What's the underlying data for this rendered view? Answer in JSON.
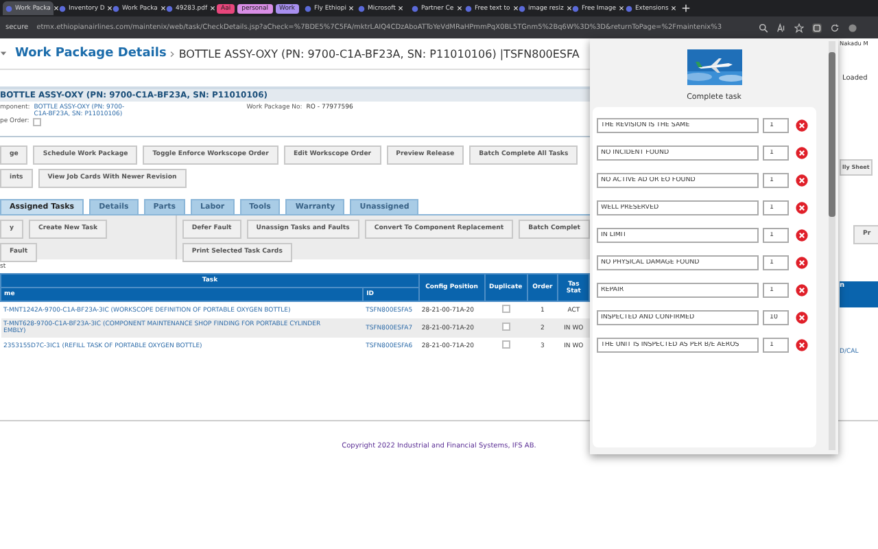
{
  "browser": {
    "tabs": [
      {
        "kind": "tab",
        "title": "Work Packa",
        "selected": true
      },
      {
        "kind": "tab",
        "title": "Inventory D",
        "selected": false
      },
      {
        "kind": "tab",
        "title": "Work Packa",
        "selected": false
      },
      {
        "kind": "tab",
        "title": "49283.pdf",
        "selected": false
      },
      {
        "kind": "group",
        "title": "Aai",
        "color": "#e8467c"
      },
      {
        "kind": "group",
        "title": "personal",
        "color": "#d98ee6"
      },
      {
        "kind": "group",
        "title": "Work",
        "color": "#a88ff0"
      },
      {
        "kind": "tab",
        "title": "Fly Ethiopi",
        "selected": false
      },
      {
        "kind": "tab",
        "title": "Microsoft",
        "selected": false
      },
      {
        "kind": "tab",
        "title": "Partner Ce",
        "selected": false
      },
      {
        "kind": "tab",
        "title": "Free text to",
        "selected": false
      },
      {
        "kind": "tab",
        "title": "image resiz",
        "selected": false
      },
      {
        "kind": "tab",
        "title": "Free Image",
        "selected": false
      },
      {
        "kind": "tab",
        "title": "Extensions",
        "selected": false
      }
    ],
    "address": {
      "prefix": "secure",
      "url": "etmx.ethiopianairlines.com/maintenix/web/task/CheckDetails.jsp?aCheck=%7BDE5%7C5FA/mktrLAIQ4CDzAboATToYeVdMRaHPmmPqX0BL5TGnm5%2Bq6W%3D%3D&returnToPage=%2Fmaintenix%3"
    }
  },
  "page": {
    "title": "Work Package Details",
    "breadcrumb": "BOTTLE ASSY-OXY (PN: 9700-C1A-BF23A, SN: P11010106) |TSFN800ESFA",
    "user": "Nakadu M",
    "status": "Loaded",
    "section_title": "BOTTLE ASSY-OXY (PN: 9700-C1A-BF23A, SN: P11010106)",
    "component": {
      "label": "mponent:",
      "value": "BOTTLE ASSY-OXY (PN: 9700-C1A-BF23A, SN: P11010106)"
    },
    "package_no": {
      "label": "Work Package No:",
      "value": "RO - 77977596"
    },
    "workscope_order": {
      "label": "pe Order:",
      "checked": false
    },
    "actions": [
      [
        "ge",
        "Schedule Work Package",
        "Toggle Enforce Workscope Order",
        "Edit Workscope Order",
        "Preview Release",
        "Batch Complete All Tasks"
      ],
      [
        "ints",
        "View Job Cards With Newer Revision"
      ]
    ],
    "side_action": "lly Sheet",
    "tabs": [
      {
        "label": "Assigned Tasks",
        "selected": true
      },
      {
        "label": "Details",
        "selected": false
      },
      {
        "label": "Parts",
        "selected": false
      },
      {
        "label": "Labor",
        "selected": false
      },
      {
        "label": "Tools",
        "selected": false
      },
      {
        "label": "Warranty",
        "selected": false
      },
      {
        "label": "Unassigned",
        "selected": false
      }
    ],
    "toolbar_left": [
      [
        "y",
        "Create New Task"
      ],
      [
        "Fault"
      ]
    ],
    "toolbar_right": [
      [
        "Defer Fault",
        "Unassign Tasks and Faults",
        "Convert To Component Replacement",
        "Batch Complet"
      ],
      [
        "Print Selected Task Cards"
      ]
    ],
    "side_toolbar": "Pr",
    "list_label": "st",
    "table": {
      "group_header": "Task",
      "columns": [
        "me",
        "ID",
        "Config Position",
        "Duplicate",
        "Order",
        "Tas Stat"
      ],
      "side_header": "n",
      "rows": [
        {
          "task": [
            "T-MNT1242A-9700-C1A-BF23A-3IC (WORKSCOPE DEFINITION OF PORTABLE OXYGEN BOTTLE)"
          ],
          "id": "TSFN800ESFA5",
          "config": "28-21-00-71A-20",
          "duplicate": false,
          "order": "1",
          "status": "ACT"
        },
        {
          "task": [
            "T-MNT628-9700-C1A-BF23A-3IC (COMPONENT MAINTENANCE SHOP FINDING FOR PORTABLE CYLINDER",
            "EMBLY)"
          ],
          "id": "TSFN800ESFA7",
          "config": "28-21-00-71A-20",
          "duplicate": false,
          "order": "2",
          "status": "IN WO"
        },
        {
          "task": [
            "2353155D7C-3IC1 (REFILL TASK OF PORTABLE OXYGEN BOTTLE)"
          ],
          "id": "TSFN800ESFA6",
          "config": "28-21-00-71A-20",
          "duplicate": false,
          "order": "3",
          "status": "IN WO"
        }
      ],
      "side_link": "D/CAL"
    },
    "footer": "Copyright 2022 Industrial and Financial Systems, IFS AB."
  },
  "dialog": {
    "title": "Complete task",
    "items": [
      {
        "text": "THE REVISION IS THE SAME",
        "count": "1"
      },
      {
        "text": "NO INCIDENT FOUND",
        "count": "1"
      },
      {
        "text": "NO ACTIVE AD OR EO FOUND",
        "count": "1"
      },
      {
        "text": "WELL PRESERVED",
        "count": "1"
      },
      {
        "text": "IN LIMIT",
        "count": "1"
      },
      {
        "text": "NO PHYSICAL DAMAGE FOUND",
        "count": "1"
      },
      {
        "text": "REPAIR",
        "count": "1"
      },
      {
        "text": "INSPECTED AND CONFIRMED",
        "count": "10"
      },
      {
        "text": "THE UNIT IS INSPECTED AS PER B/E AEROS",
        "count": "1"
      }
    ]
  }
}
